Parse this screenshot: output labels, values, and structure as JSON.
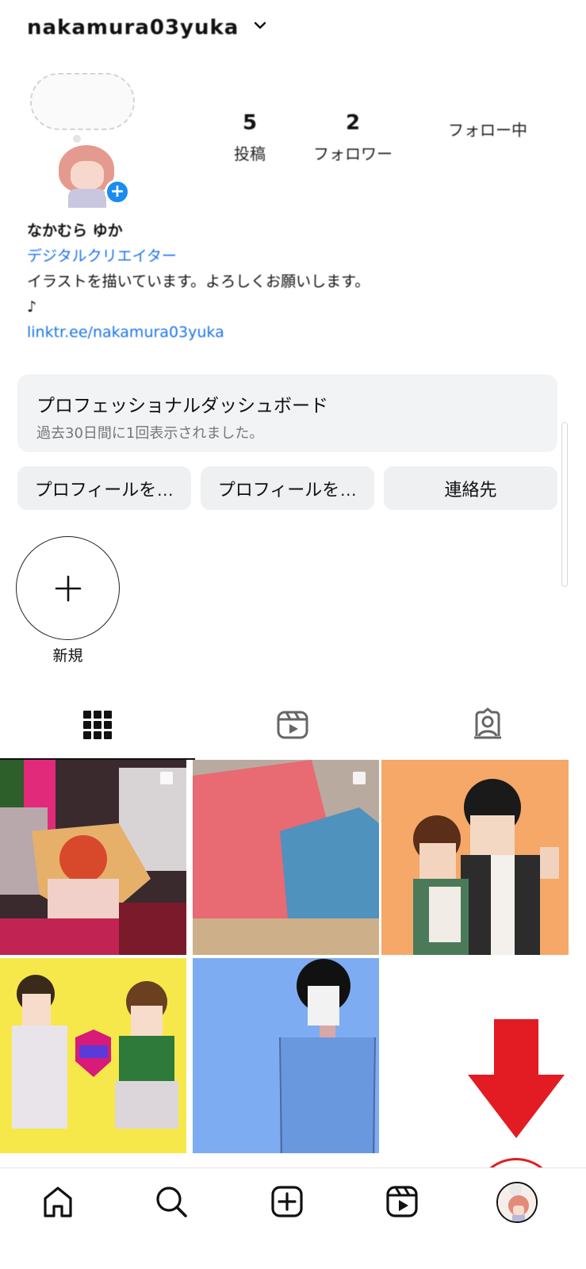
{
  "header": {
    "username": "nakamura03yuka",
    "account_switch_icon": "chevron-down-icon"
  },
  "profile": {
    "stats": [
      {
        "value": "5",
        "label": "投稿"
      },
      {
        "value": "2",
        "label": "フォロワー"
      },
      {
        "value": "",
        "label": "フォロー中"
      }
    ],
    "bio": {
      "name": "なかむら ゆか",
      "category": "デジタルクリエイター",
      "text_line1": "イラストを描いています。よろしくお願いします。",
      "text_line2": "♪",
      "link": "linktr.ee/nakamura03yuka"
    }
  },
  "dashboard": {
    "title": "プロフェッショナルダッシュボード",
    "subtitle": "過去30日間に1回表示されました。"
  },
  "actions": [
    {
      "label": "プロフィールを…"
    },
    {
      "label": "プロフィールを…"
    },
    {
      "label": "連絡先"
    }
  ],
  "highlights": {
    "new_label": "新規",
    "new_icon": "plus-icon"
  },
  "tabs": [
    {
      "icon": "grid-icon",
      "active": true
    },
    {
      "icon": "reels-icon",
      "active": false
    },
    {
      "icon": "tagged-icon",
      "active": false
    }
  ],
  "bottom_nav": [
    {
      "icon": "home-icon"
    },
    {
      "icon": "search-icon"
    },
    {
      "icon": "create-icon"
    },
    {
      "icon": "reels-icon"
    },
    {
      "icon": "profile-avatar"
    }
  ],
  "colors": {
    "accent_blue": "#1a8cf0",
    "annotation_red": "#e31b23",
    "button_bg": "#eff0f2"
  }
}
